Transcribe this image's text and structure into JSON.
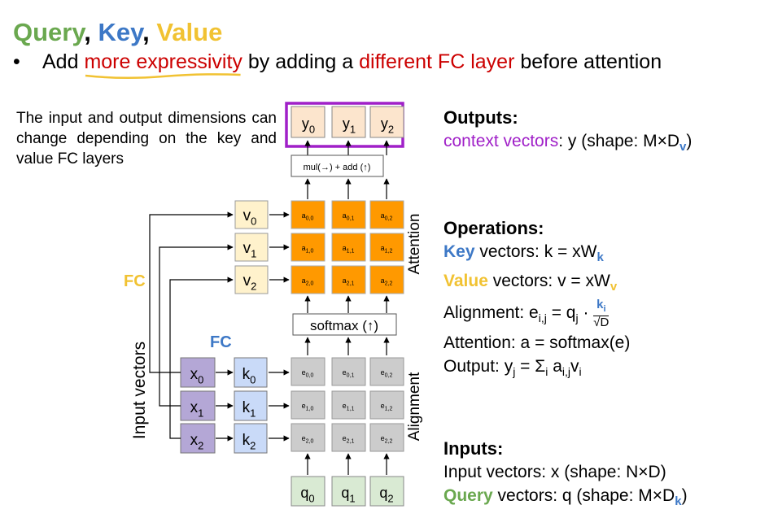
{
  "title": {
    "query": "Query",
    "sep1": ", ",
    "key": "Key",
    "sep2": ", ",
    "value": "Value"
  },
  "bullet": {
    "dot": "•",
    "pre": "Add ",
    "highlight1": "more expressivity",
    "mid": " by adding a ",
    "highlight2": "different FC layer",
    "post": " before attention"
  },
  "note": "The input and output dimensions can change depending on the key and value FC layers",
  "outputs": {
    "heading": "Outputs:",
    "context": "context vectors",
    "rest": ": y (shape: M×D",
    "sub": "v",
    "close": ")"
  },
  "operations": {
    "heading": "Operations:",
    "key_word": "Key",
    "key_rest": " vectors: k = xW",
    "key_sub": "k",
    "value_word": "Value",
    "value_rest": " vectors: v = xW",
    "value_sub": "v",
    "alignment": "Alignment: e",
    "alignment_sub": "i,j",
    "alignment_mid": " = q",
    "alignment_q_sub": "j",
    "alignment_frac_num": "k",
    "alignment_frac_num_sub": "i",
    "alignment_frac_den": "√D",
    "attention": "Attention: a = softmax(e)",
    "output": "Output: y",
    "output_sub": "j",
    "output_rest": " = Σ",
    "output_sum_sub": "i",
    "output_tail": " a",
    "output_tail_sub": "i,j",
    "output_end": "v",
    "output_end_sub": "i"
  },
  "inputs": {
    "heading": "Inputs:",
    "line1": "Input vectors: x (shape: N×D)",
    "query_word": "Query",
    "line2_rest": " vectors: q (shape: M×D",
    "line2_sub": "k",
    "line2_close": ")"
  },
  "diagram": {
    "outputs_y": [
      {
        "b": "y",
        "s": "0"
      },
      {
        "b": "y",
        "s": "1"
      },
      {
        "b": "y",
        "s": "2"
      }
    ],
    "mul_add": "mul(→) + add (↑)",
    "values_v": [
      {
        "b": "v",
        "s": "0"
      },
      {
        "b": "v",
        "s": "1"
      },
      {
        "b": "v",
        "s": "2"
      }
    ],
    "attention_cells": [
      [
        {
          "b": "a",
          "s": "0,0"
        },
        {
          "b": "a",
          "s": "0,1"
        },
        {
          "b": "a",
          "s": "0,2"
        }
      ],
      [
        {
          "b": "a",
          "s": "1,0"
        },
        {
          "b": "a",
          "s": "1,1"
        },
        {
          "b": "a",
          "s": "1,2"
        }
      ],
      [
        {
          "b": "a",
          "s": "2,0"
        },
        {
          "b": "a",
          "s": "2,1"
        },
        {
          "b": "a",
          "s": "2,2"
        }
      ]
    ],
    "attention_label": "Attention",
    "softmax": "softmax (↑)",
    "fc_value_label": "FC",
    "fc_key_label": "FC",
    "inputs_x": [
      {
        "b": "x",
        "s": "0"
      },
      {
        "b": "x",
        "s": "1"
      },
      {
        "b": "x",
        "s": "2"
      }
    ],
    "keys_k": [
      {
        "b": "k",
        "s": "0"
      },
      {
        "b": "k",
        "s": "1"
      },
      {
        "b": "k",
        "s": "2"
      }
    ],
    "alignment_cells": [
      [
        {
          "b": "e",
          "s": "0,0"
        },
        {
          "b": "e",
          "s": "0,1"
        },
        {
          "b": "e",
          "s": "0,2"
        }
      ],
      [
        {
          "b": "e",
          "s": "1,0"
        },
        {
          "b": "e",
          "s": "1,1"
        },
        {
          "b": "e",
          "s": "1,2"
        }
      ],
      [
        {
          "b": "e",
          "s": "2,0"
        },
        {
          "b": "e",
          "s": "2,1"
        },
        {
          "b": "e",
          "s": "2,2"
        }
      ]
    ],
    "alignment_label": "Alignment",
    "input_vectors_label": "Input vectors",
    "queries_q": [
      {
        "b": "q",
        "s": "0"
      },
      {
        "b": "q",
        "s": "1"
      },
      {
        "b": "q",
        "s": "2"
      }
    ]
  },
  "colors": {
    "green": "#6aa84f",
    "blue": "#3d78c6",
    "yellow": "#f1c232",
    "red": "#cc0000",
    "purple": "#a020c8",
    "orange": "#ff9900",
    "value_fill": "#fff2cc",
    "key_fill": "#c9daf8",
    "input_fill": "#b4a7d6",
    "query_fill": "#d9ead3",
    "output_fill": "#fce5cd",
    "align_fill": "#cccccc"
  }
}
